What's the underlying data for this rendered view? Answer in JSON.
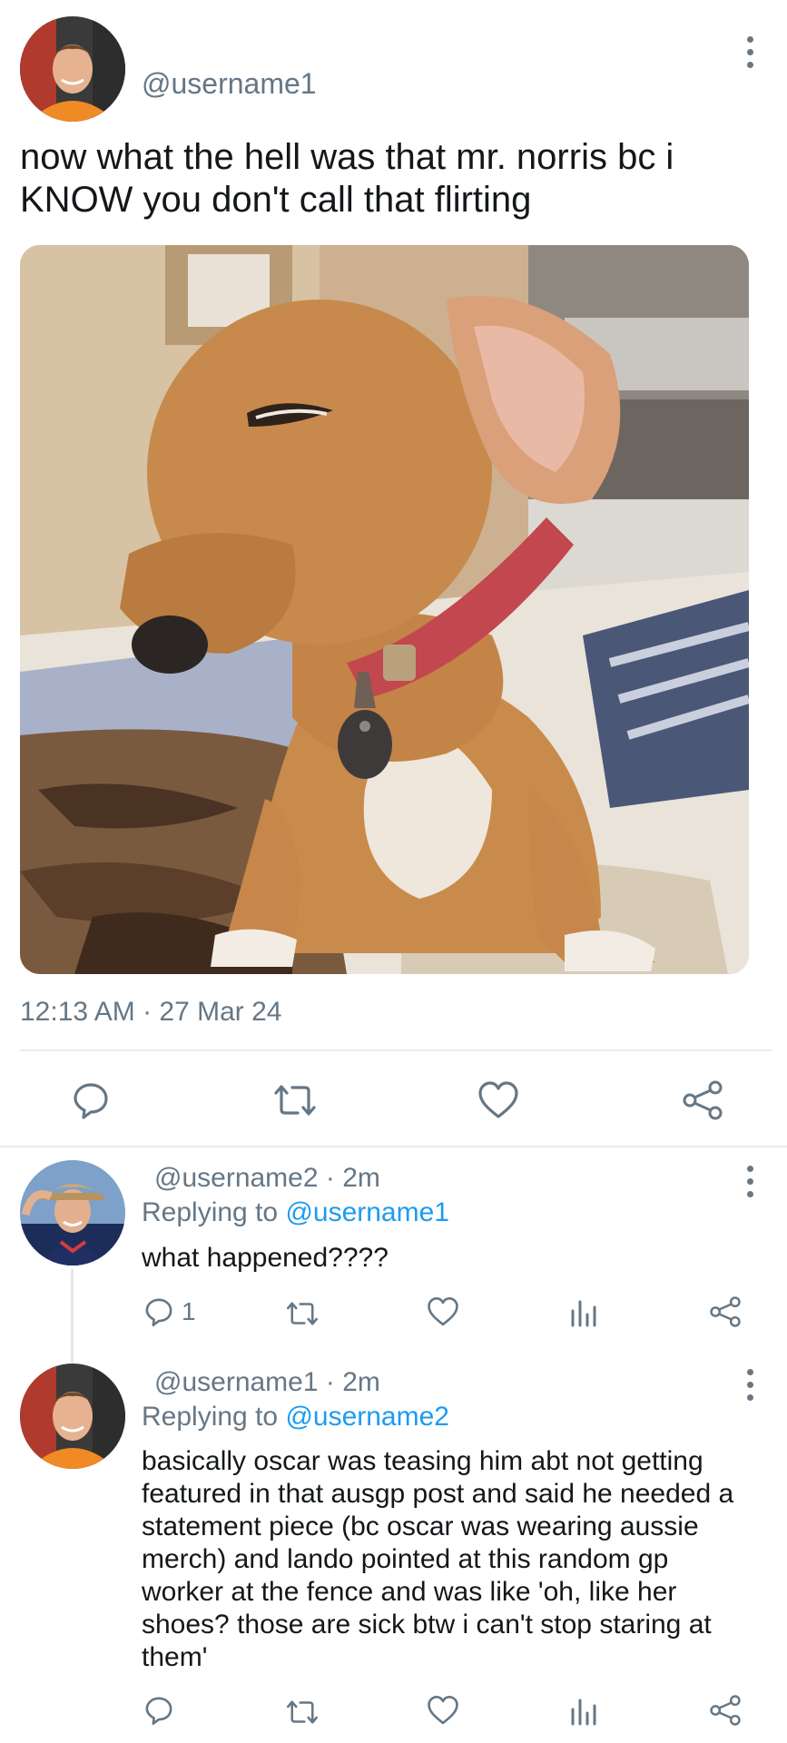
{
  "main_tweet": {
    "handle": "@username1",
    "text_line1": "now what the hell was that mr. norris bc i",
    "text_line2": "KNOW you don't call that flirting",
    "timestamp": "12:13 AM · 27 Mar 24",
    "avatar_icon": "profile-photo"
  },
  "replies": [
    {
      "handle": "@username2",
      "time": "2m",
      "replying_prefix": "Replying to",
      "replying_to": "@username1",
      "text": "what happened????",
      "reply_count": "1"
    },
    {
      "handle": "@username1",
      "time": "2m",
      "replying_prefix": "Replying to",
      "replying_to": "@username2",
      "text_lines": [
        "basically oscar was teasing him abt not getting",
        "featured in that ausgp post and said he needed a",
        "statement piece (bc oscar was wearing aussie",
        "merch) and lando pointed at this random gp",
        "worker at the fence and was like 'oh, like her",
        "shoes? those are sick btw i can't stop staring at",
        "them'"
      ]
    }
  ],
  "icons": {
    "reply": "reply-icon",
    "retweet": "retweet-icon",
    "like": "heart-icon",
    "share": "share-icon",
    "stats": "stats-icon",
    "menu": "more-vertical-icon"
  },
  "colors": {
    "link": "#1d9bf0",
    "muted": "#657786",
    "divider": "#e6ecf0"
  }
}
